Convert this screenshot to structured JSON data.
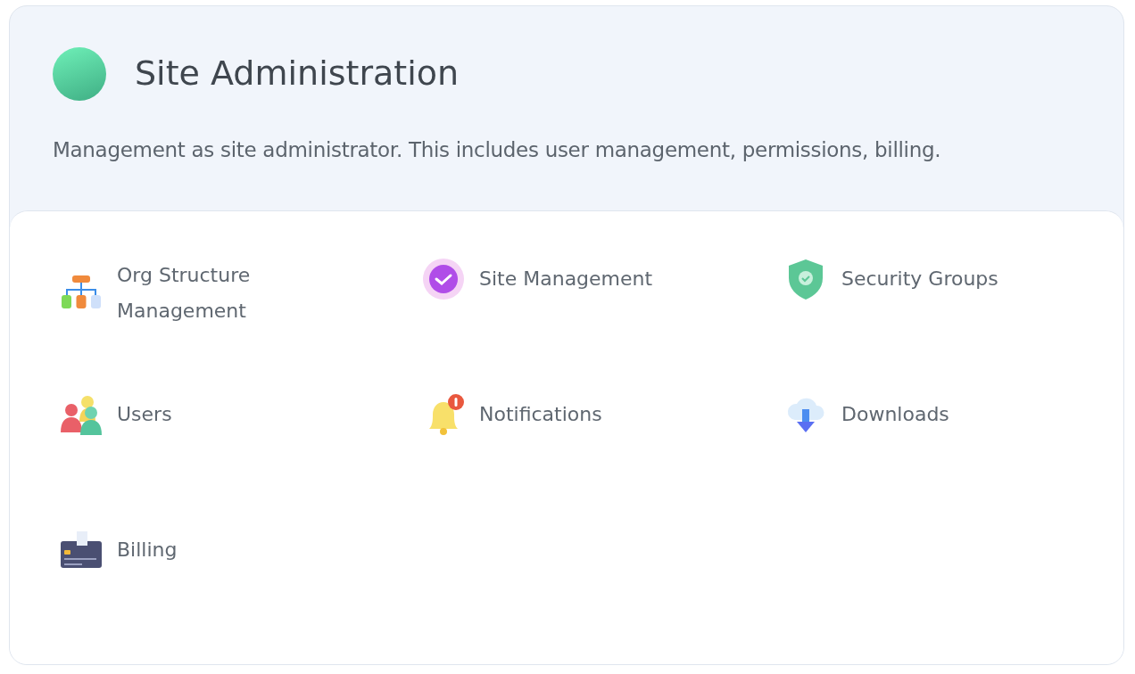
{
  "header": {
    "title": "Site Administration",
    "description": "Management as site administrator. This includes user management, permissions, billing."
  },
  "items": [
    {
      "label": "Org Structure Management"
    },
    {
      "label": "Site Management"
    },
    {
      "label": "Security Groups"
    },
    {
      "label": "Users"
    },
    {
      "label": "Notifications"
    },
    {
      "label": "Downloads"
    },
    {
      "label": "Billing"
    }
  ]
}
